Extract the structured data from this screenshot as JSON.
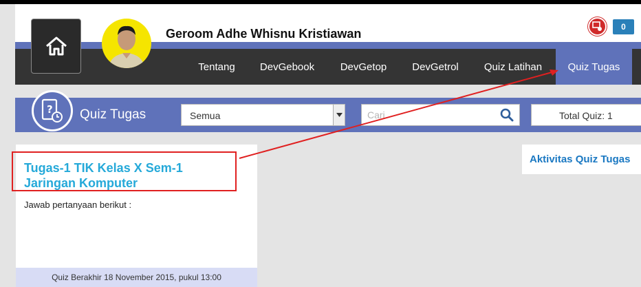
{
  "profile": {
    "name": "Geroom Adhe Whisnu Kristiawan"
  },
  "notifications": {
    "count": "0"
  },
  "nav": {
    "items": [
      {
        "label": "Tentang",
        "active": false
      },
      {
        "label": "DevGebook",
        "active": false
      },
      {
        "label": "DevGetop",
        "active": false
      },
      {
        "label": "DevGetrol",
        "active": false
      },
      {
        "label": "Quiz Latihan",
        "active": false
      },
      {
        "label": "Quiz Tugas",
        "active": true
      }
    ]
  },
  "quiz_bar": {
    "title": "Quiz Tugas",
    "filter_value": "Semua",
    "search_placeholder": "Cari",
    "total_label": "Total Quiz: 1"
  },
  "quiz_card": {
    "title": "Tugas-1 TIK Kelas X Sem-1 Jaringan Komputer",
    "description": "Jawab pertanyaan berikut :",
    "footer": "Quiz Berakhir 18 November 2015, pukul 13:00"
  },
  "activity": {
    "title": "Aktivitas Quiz Tugas"
  },
  "colors": {
    "accent": "#5f72ba",
    "nav_bg": "#343434",
    "title_link": "#25a9d9",
    "annotation": "#e02020",
    "badge": "#2a80b9"
  }
}
